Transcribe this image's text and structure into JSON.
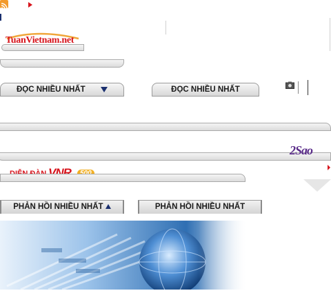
{
  "header": {
    "logo_text": "TuanVietnam.net"
  },
  "most_read": {
    "tab_active_label": "ĐỌC NHIỀU NHẤT",
    "tab_other_label": "ĐỌC NHIỀU NHẤT"
  },
  "brand": {
    "two_sao_logo": "2Sao"
  },
  "forum": {
    "label": "DIỄN ĐÀN",
    "brand": "VNR",
    "badge": "500"
  },
  "replies": {
    "tab_active_label": "PHẢN HỒI NHIỀU NHẤT",
    "tab_other_label": "PHẢN HỒI NHIỀU NHẤT"
  },
  "icons": [
    "rss-icon",
    "arrow-right-icon",
    "camera-icon",
    "triangle-down-icon",
    "triangle-up-icon",
    "chevron-down-icon"
  ],
  "colors": {
    "brand_red": "#d7141c",
    "tab_text": "#1a1a1a",
    "bar_gray": "#dcdcdc",
    "banner_blue": "#2f6fb3"
  }
}
